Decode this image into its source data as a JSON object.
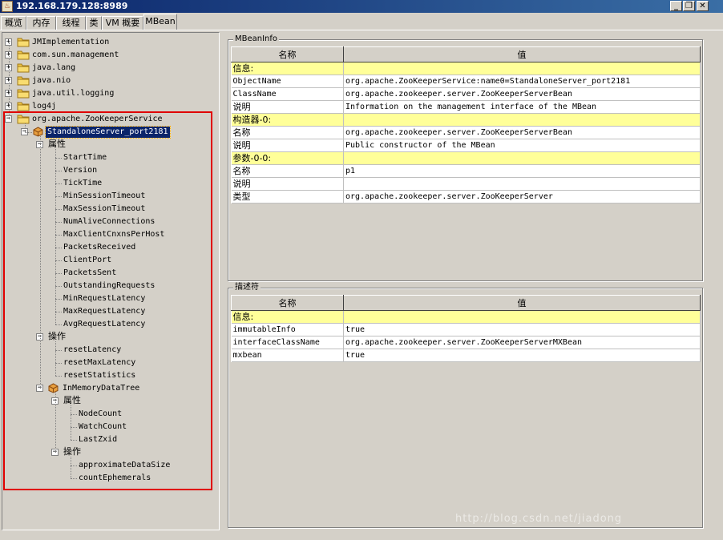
{
  "window": {
    "title": "192.168.179.128:8989"
  },
  "tabs": [
    {
      "label": "概览",
      "active": false
    },
    {
      "label": "内存",
      "active": false
    },
    {
      "label": "线程",
      "active": false
    },
    {
      "label": "类",
      "active": false
    },
    {
      "label": "VM 概要",
      "active": false
    },
    {
      "label": "MBean",
      "active": true
    }
  ],
  "tree": {
    "top_domains": [
      "JMImplementation",
      "com.sun.management",
      "java.lang",
      "java.nio",
      "java.util.logging",
      "log4j"
    ],
    "root": "org.apache.ZooKeeperService",
    "server": "StandaloneServer_port2181",
    "attributes_label": "属性",
    "attributes": [
      "StartTime",
      "Version",
      "TickTime",
      "MinSessionTimeout",
      "MaxSessionTimeout",
      "NumAliveConnections",
      "MaxClientCnxnsPerHost",
      "PacketsReceived",
      "ClientPort",
      "PacketsSent",
      "OutstandingRequests",
      "MinRequestLatency",
      "MaxRequestLatency",
      "AvgRequestLatency"
    ],
    "operations_label": "操作",
    "operations": [
      "resetLatency",
      "resetMaxLatency",
      "resetStatistics"
    ],
    "datatree": "InMemoryDataTree",
    "datatree_attributes_label": "属性",
    "datatree_attributes": [
      "NodeCount",
      "WatchCount",
      "LastZxid"
    ],
    "datatree_operations_label": "操作",
    "datatree_operations": [
      "approximateDataSize",
      "countEphemerals"
    ]
  },
  "mbeaninfo": {
    "title": "MBeanInfo",
    "col_name": "名称",
    "col_value": "值",
    "rows": [
      {
        "name": "信息:",
        "value": "",
        "section": true
      },
      {
        "name": "ObjectName",
        "value": "org.apache.ZooKeeperService:name0=StandaloneServer_port2181",
        "section": false
      },
      {
        "name": "ClassName",
        "value": "org.apache.zookeeper.server.ZooKeeperServerBean",
        "section": false
      },
      {
        "name": "说明",
        "value": "Information on the management interface of the MBean",
        "section": false
      },
      {
        "name": "构造器-0:",
        "value": "",
        "section": true
      },
      {
        "name": "名称",
        "value": "org.apache.zookeeper.server.ZooKeeperServerBean",
        "section": false
      },
      {
        "name": "说明",
        "value": "Public constructor of the MBean",
        "section": false
      },
      {
        "name": "参数-0-0:",
        "value": "",
        "section": true
      },
      {
        "name": "名称",
        "value": "p1",
        "section": false
      },
      {
        "name": "说明",
        "value": "",
        "section": false
      },
      {
        "name": "类型",
        "value": "org.apache.zookeeper.server.ZooKeeperServer",
        "section": false
      }
    ]
  },
  "descriptor": {
    "title": "描述符",
    "col_name": "名称",
    "col_value": "值",
    "rows": [
      {
        "name": "信息:",
        "value": "",
        "section": true
      },
      {
        "name": "immutableInfo",
        "value": "true",
        "section": false
      },
      {
        "name": "interfaceClassName",
        "value": "org.apache.zookeeper.server.ZooKeeperServerMXBean",
        "section": false
      },
      {
        "name": "mxbean",
        "value": "true",
        "section": false
      }
    ]
  },
  "watermark": "http://blog.csdn.net/jiadong"
}
